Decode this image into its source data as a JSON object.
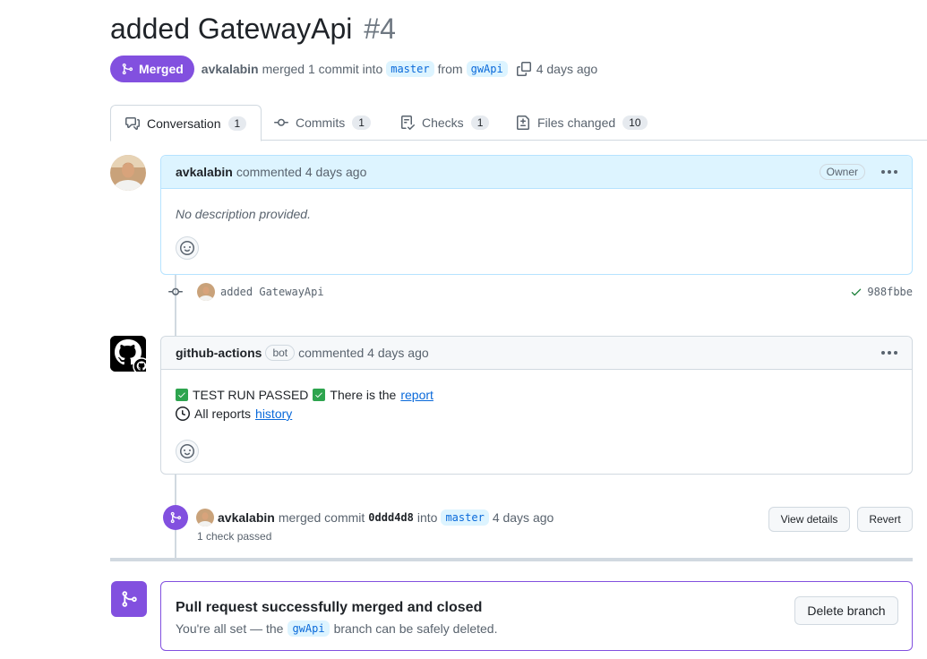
{
  "pr": {
    "title": "added GatewayApi",
    "number": "#4",
    "state": "Merged",
    "author": "avkalabin",
    "merge_text": "merged 1 commit into",
    "base_branch": "master",
    "from_text": "from",
    "head_branch": "gwApi",
    "time": "4 days ago"
  },
  "tabs": [
    {
      "label": "Conversation",
      "count": "1",
      "icon": "comment-discussion-icon"
    },
    {
      "label": "Commits",
      "count": "1",
      "icon": "git-commit-icon"
    },
    {
      "label": "Checks",
      "count": "1",
      "icon": "checklist-icon"
    },
    {
      "label": "Files changed",
      "count": "10",
      "icon": "file-diff-icon"
    }
  ],
  "comment1": {
    "author": "avkalabin",
    "action": "commented 4 days ago",
    "role": "Owner",
    "body": "No description provided."
  },
  "commit": {
    "message": "added GatewayApi",
    "sha": "988fbbe"
  },
  "comment2": {
    "author": "github-actions",
    "bot_label": "bot",
    "action": "commented 4 days ago",
    "line1_text": "TEST RUN PASSED",
    "line1_mid": "There is the",
    "line1_link": "report",
    "line2_text": "All reports",
    "line2_link": "history"
  },
  "merge_event": {
    "author": "avkalabin",
    "text": "merged commit",
    "sha": "0ddd4d8",
    "into": "into",
    "branch": "master",
    "time": "4 days ago",
    "checks": "1 check passed",
    "view_details": "View details",
    "revert": "Revert"
  },
  "final": {
    "title": "Pull request successfully merged and closed",
    "pre": "You're all set — the",
    "branch": "gwApi",
    "post": "branch can be safely deleted.",
    "delete_button": "Delete branch"
  },
  "colors": {
    "merged_purple": "#8250df",
    "link_blue": "#0969da",
    "owner_header": "#ddf4ff",
    "success_green": "#1a7f37"
  }
}
